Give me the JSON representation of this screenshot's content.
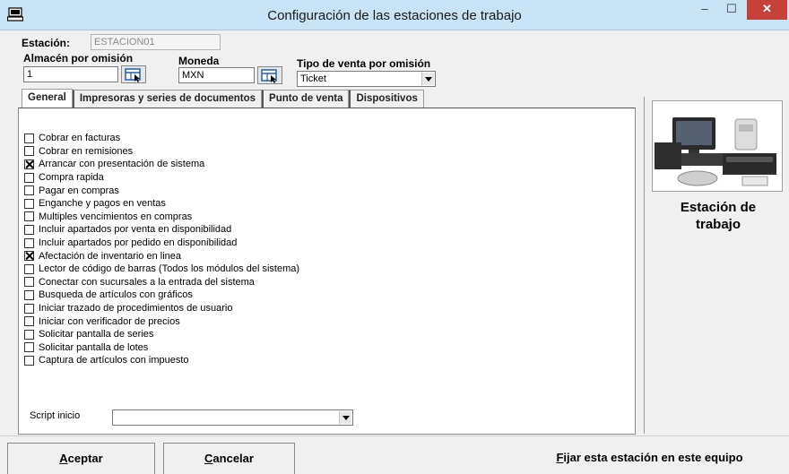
{
  "window": {
    "title": "Configuración de las estaciones de trabajo",
    "min_glyph": "–",
    "max_glyph": "☐",
    "close_glyph": "✕",
    "accent_close": "#c7403a",
    "titlebar_color": "#c8e3f5"
  },
  "header": {
    "estacion_label": "Estación:",
    "estacion_value": "ESTACION01",
    "almacen_label": "Almacén por omisión",
    "almacen_value": "1",
    "moneda_label": "Moneda",
    "moneda_value": "MXN",
    "tipo_venta_label": "Tipo de venta por omisión",
    "tipo_venta_value": "Ticket"
  },
  "tabs": [
    {
      "label": "General",
      "active": true
    },
    {
      "label": "Impresoras  y series de documentos",
      "active": false
    },
    {
      "label": "Punto de venta",
      "active": false
    },
    {
      "label": "Dispositivos",
      "active": false
    }
  ],
  "options": [
    {
      "label": "Cobrar en facturas",
      "checked": false
    },
    {
      "label": "Cobrar en remisiones",
      "checked": false
    },
    {
      "label": "Arrancar con presentación de sistema",
      "checked": true
    },
    {
      "label": "Compra rapida",
      "checked": false
    },
    {
      "label": "Pagar en compras",
      "checked": false
    },
    {
      "label": "Enganche y pagos en ventas",
      "checked": false
    },
    {
      "label": "Multiples vencimientos en compras",
      "checked": false
    },
    {
      "label": "Incluir apartados por venta en disponibilidad",
      "checked": false
    },
    {
      "label": "Incluir apartados por pedido en disponibilidad",
      "checked": false
    },
    {
      "label": "Afectación de inventario en linea",
      "checked": true
    },
    {
      "label": "Lector de código de barras (Todos los módulos del sistema)",
      "checked": false
    },
    {
      "label": "Conectar con sucursales a la entrada del sistema",
      "checked": false
    },
    {
      "label": "Busqueda de artículos con gráficos",
      "checked": false
    },
    {
      "label": "Iniciar trazado de procedimientos de usuario",
      "checked": false
    },
    {
      "label": "Iniciar con verificador de precios",
      "checked": false
    },
    {
      "label": "Solicitar pantalla de series",
      "checked": false
    },
    {
      "label": "Solicitar pantalla de lotes",
      "checked": false
    },
    {
      "label": "Captura de artículos con impuesto",
      "checked": false
    }
  ],
  "script": {
    "label": "Script inicio",
    "value": ""
  },
  "side": {
    "line1": "Estación de",
    "line2": "trabajo"
  },
  "buttons": {
    "aceptar_accel": "A",
    "aceptar_rest": "ceptar",
    "cancelar_accel": "C",
    "cancelar_rest": "ancelar",
    "fijar_accel": "F",
    "fijar_rest": "ijar esta estación en este equipo"
  }
}
